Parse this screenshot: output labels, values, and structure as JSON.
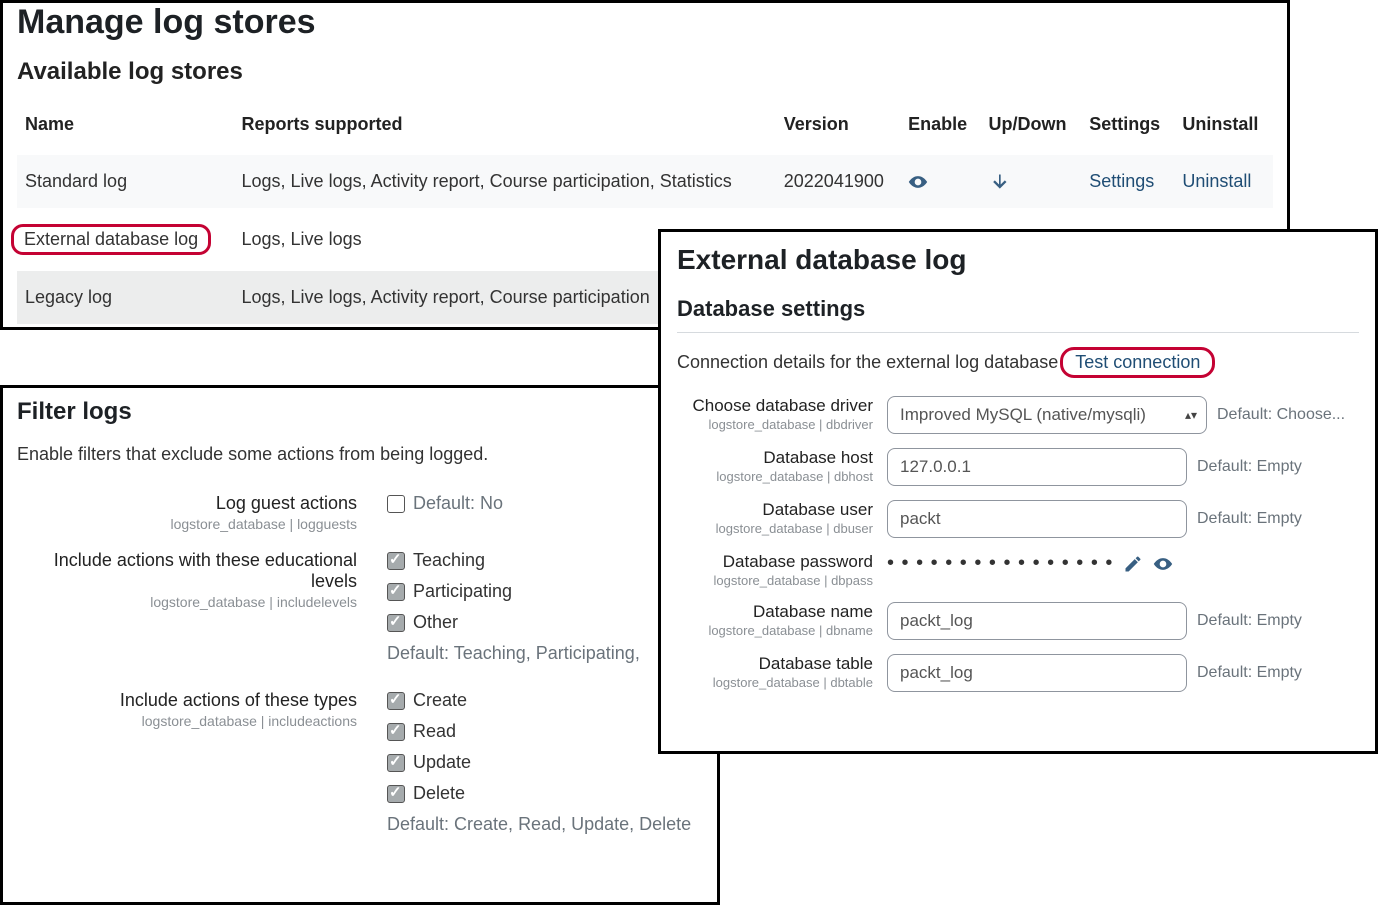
{
  "manage": {
    "title": "Manage log stores",
    "subtitle": "Available log stores",
    "cols": {
      "name": "Name",
      "reports": "Reports supported",
      "version": "Version",
      "enable": "Enable",
      "updown": "Up/Down",
      "settings": "Settings",
      "uninstall": "Uninstall"
    },
    "rows": [
      {
        "name": "Standard log",
        "reports": "Logs, Live logs, Activity report, Course participation, Statistics",
        "version": "2022041900",
        "settings": "Settings",
        "uninstall": "Uninstall"
      },
      {
        "name": "External database log",
        "reports": "Logs, Live logs"
      },
      {
        "name": "Legacy log",
        "reports": "Logs, Live logs, Activity report, Course participation"
      }
    ]
  },
  "filter": {
    "title": "Filter logs",
    "lead": "Enable filters that exclude some actions from being logged.",
    "items": {
      "guest": {
        "label": "Log guest actions",
        "sub": "logstore_database | logguests",
        "default": "Default: No"
      },
      "levels": {
        "label": "Include actions with these educational levels",
        "sub": "logstore_database | includelevels",
        "opts": [
          "Teaching",
          "Participating",
          "Other"
        ],
        "default": "Default: Teaching, Participating,"
      },
      "types": {
        "label": "Include actions of these types",
        "sub": "logstore_database | includeactions",
        "opts": [
          "Create",
          "Read",
          "Update",
          "Delete"
        ],
        "default": "Default: Create, Read, Update, Delete"
      }
    }
  },
  "ext": {
    "title": "External database log",
    "section": "Database settings",
    "connText": "Connection details for the external log database",
    "testLink": "Test connection",
    "fields": {
      "driver": {
        "label": "Choose database driver",
        "sub": "logstore_database | dbdriver",
        "value": "Improved MySQL (native/mysqli)",
        "default": "Default: Choose..."
      },
      "host": {
        "label": "Database host",
        "sub": "logstore_database | dbhost",
        "value": "127.0.0.1",
        "default": "Default: Empty"
      },
      "user": {
        "label": "Database user",
        "sub": "logstore_database | dbuser",
        "value": "packt",
        "default": "Default: Empty"
      },
      "pass": {
        "label": "Database password",
        "sub": "logstore_database | dbpass",
        "mask": "• • • • • • • • • • • • • • • •"
      },
      "name": {
        "label": "Database name",
        "sub": "logstore_database | dbname",
        "value": "packt_log",
        "default": "Default: Empty"
      },
      "table": {
        "label": "Database table",
        "sub": "logstore_database | dbtable",
        "value": "packt_log",
        "default": "Default: Empty"
      }
    }
  }
}
